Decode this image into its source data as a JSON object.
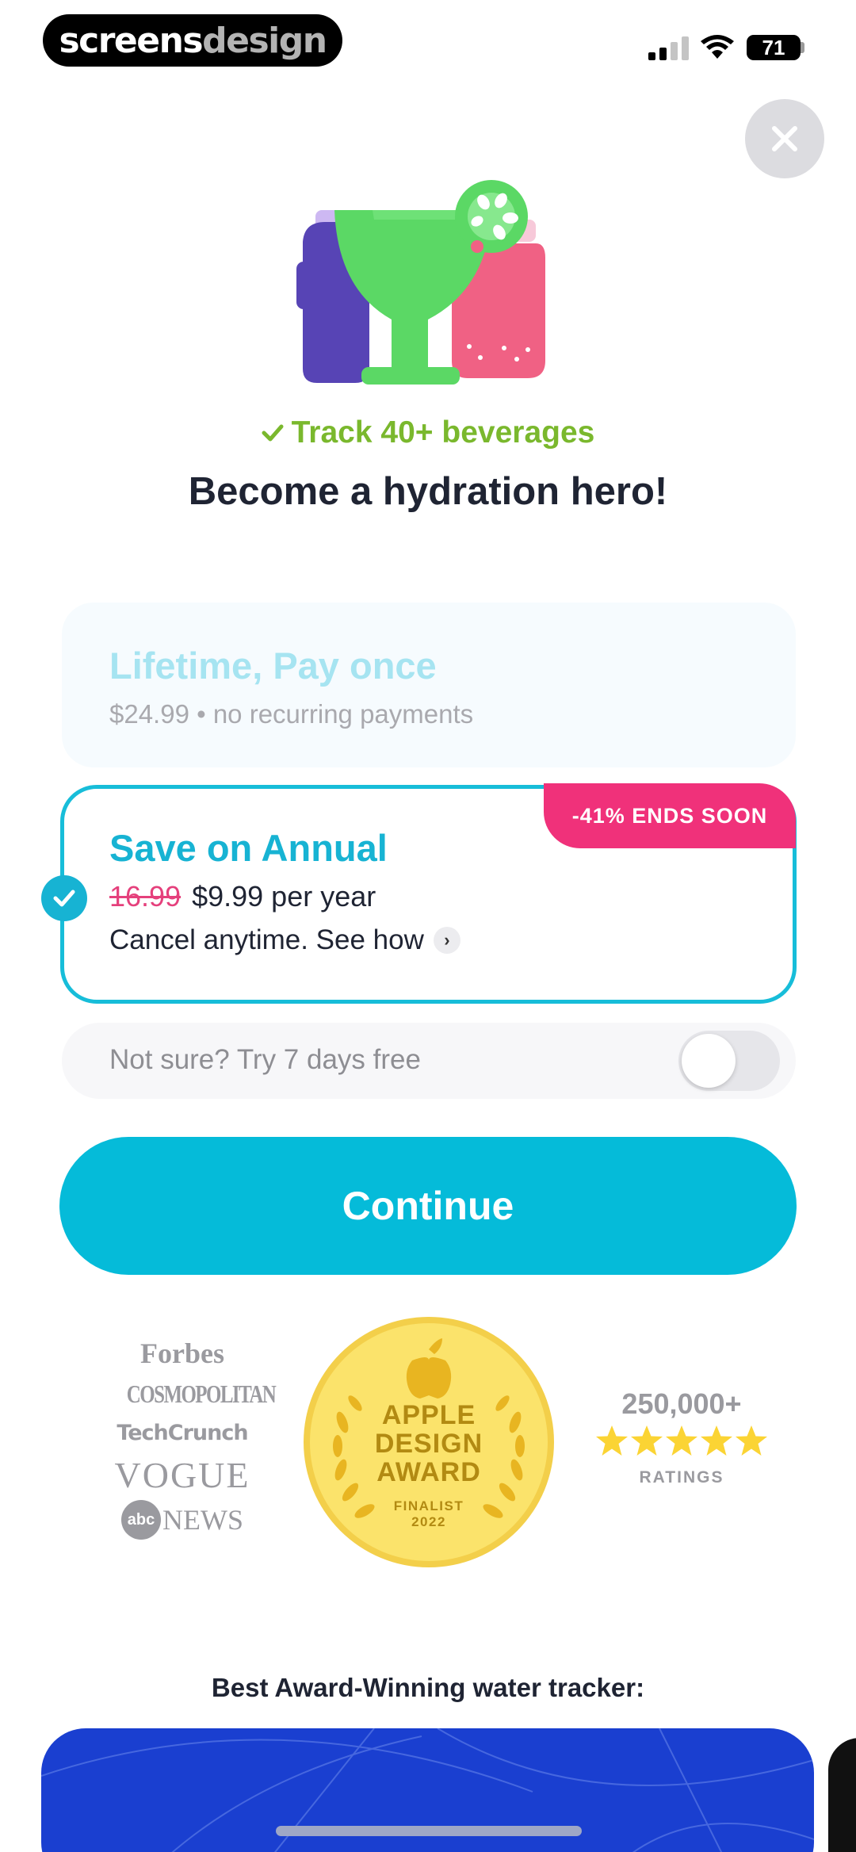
{
  "status_bar": {
    "brand_primary": "screens",
    "brand_secondary": "design",
    "battery": "71"
  },
  "icons": {
    "close": "close-icon",
    "check": "check-icon",
    "chevron": "chevron-right-icon",
    "apple": "apple-icon",
    "star": "star-icon"
  },
  "hero": {
    "feature": "Track 40+ beverages",
    "headline": "Become a hydration hero!"
  },
  "plans": {
    "lifetime": {
      "title": "Lifetime, Pay once",
      "subtitle": "$24.99 • no recurring payments"
    },
    "annual": {
      "badge": "-41% ENDS SOON",
      "title": "Save on Annual",
      "price_old": "16.99",
      "price_new": "$9.99 per year",
      "cancel": "Cancel anytime. See how",
      "selected": true
    }
  },
  "trial": {
    "label": "Not sure? Try 7 days free",
    "enabled": false
  },
  "cta": {
    "continue": "Continue"
  },
  "press": [
    "Forbes",
    "COSMOPOLITAN",
    "TechCrunch",
    "VOGUE",
    "NEWS"
  ],
  "press_abc": "abc",
  "award": {
    "line1": "APPLE",
    "line2": "DESIGN",
    "line3": "AWARD",
    "line4": "FINALIST",
    "line5": "2022"
  },
  "ratings": {
    "count": "250,000+",
    "label": "RATINGS",
    "stars": 5
  },
  "footer": {
    "award_line": "Best Award-Winning water tracker:"
  },
  "colors": {
    "accent": "#05bbd9",
    "badge": "#f0317a",
    "feature_green": "#7ab82d",
    "promo_blue": "#1a3fd0"
  }
}
